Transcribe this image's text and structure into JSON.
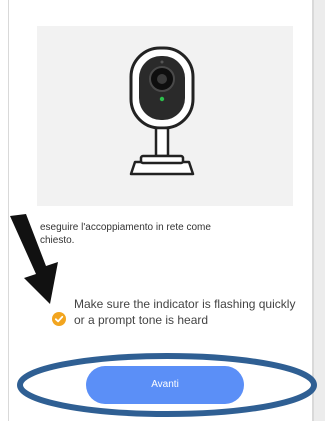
{
  "instruction": {
    "line1": "eseguire l'accoppiamento in rete come",
    "line2": "chiesto."
  },
  "hint": {
    "text": "Make sure the indicator is flashing quickly or a prompt tone is heard",
    "checked": true
  },
  "button": {
    "label": "Avanti"
  },
  "colors": {
    "accent": "#5b8ff7",
    "check": "#f2a51f",
    "annotation": "#2f5f93",
    "indicator_led": "#2dbf4d"
  },
  "icons": {
    "check": "check-circle-icon",
    "arrow": "annotation-arrow",
    "camera": "camera-illustration"
  }
}
